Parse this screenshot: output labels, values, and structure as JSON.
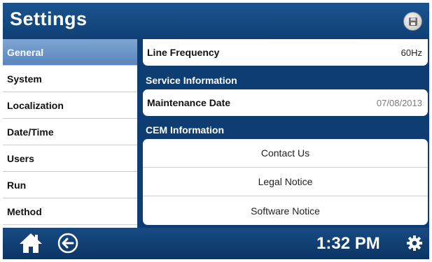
{
  "header": {
    "title": "Settings",
    "save_icon": "save-disk-icon"
  },
  "sidebar": {
    "items": [
      {
        "label": "General",
        "active": true
      },
      {
        "label": "System",
        "active": false
      },
      {
        "label": "Localization",
        "active": false
      },
      {
        "label": "Date/Time",
        "active": false
      },
      {
        "label": "Users",
        "active": false
      },
      {
        "label": "Run",
        "active": false
      },
      {
        "label": "Method",
        "active": false
      }
    ]
  },
  "main": {
    "line_frequency": {
      "label": "Line Frequency",
      "value": "60Hz"
    },
    "service_section": {
      "title": "Service Information",
      "maintenance": {
        "label": "Maintenance Date",
        "value": "07/08/2013"
      }
    },
    "cem_section": {
      "title": "CEM Information",
      "buttons": [
        "Contact Us",
        "Legal Notice",
        "Software Notice"
      ]
    }
  },
  "footer": {
    "time": "1:32 PM",
    "home_icon": "home-icon",
    "back_icon": "back-arrow-icon",
    "settings_icon": "gear-icon"
  },
  "colors": {
    "primary_blue": "#0e3d73",
    "header_blue": "#1c5490",
    "active_item": "#6a93c6",
    "panel_white": "#ffffff"
  }
}
